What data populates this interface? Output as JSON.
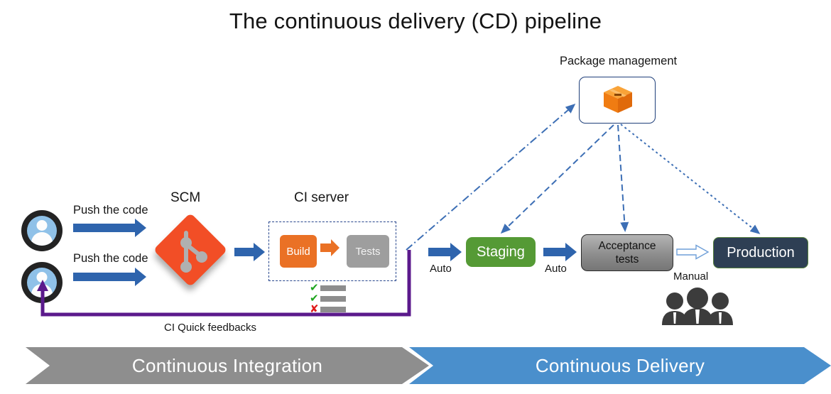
{
  "title": "The continuous delivery (CD) pipeline",
  "sections": {
    "scm_header": "SCM",
    "ci_header": "CI server",
    "package_header": "Package management"
  },
  "developers": [
    {
      "push_label": "Push the code"
    },
    {
      "push_label": "Push the code"
    }
  ],
  "ci_server": {
    "build_label": "Build",
    "tests_label": "Tests",
    "checklist": [
      {
        "mark": "✔",
        "status": "pass"
      },
      {
        "mark": "✔",
        "status": "pass"
      },
      {
        "mark": "✘",
        "status": "fail"
      }
    ],
    "feedback_label": "CI Quick feedbacks"
  },
  "stages": [
    {
      "name": "Staging",
      "trigger": "Auto"
    },
    {
      "name": "Acceptance tests",
      "line1": "Acceptance",
      "line2": "tests",
      "trigger": "Auto"
    },
    {
      "name": "Production",
      "trigger": "Manual"
    }
  ],
  "triggers": {
    "staging": "Auto",
    "acceptance": "Auto",
    "production": "Manual"
  },
  "bands": [
    {
      "label": "Continuous Integration",
      "color": "#8e8e8e"
    },
    {
      "label": "Continuous Delivery",
      "color": "#4a8fcc"
    }
  ],
  "icons": {
    "git": "git-logo-icon",
    "package": "package-box-icon",
    "people": "people-group-icon",
    "avatar": "user-avatar-icon"
  },
  "colors": {
    "build": "#ea7125",
    "tests": "#9e9e9e",
    "staging": "#559a35",
    "acceptance": "#8d8d8d",
    "production": "#2e3f54",
    "arrow_blue": "#2e64ad",
    "dashed_blue": "#3d6fb5",
    "feedback_purple": "#5b1a8c",
    "git_red": "#f24e26",
    "band_gray": "#8e8e8e",
    "band_blue": "#4a8fcc"
  }
}
